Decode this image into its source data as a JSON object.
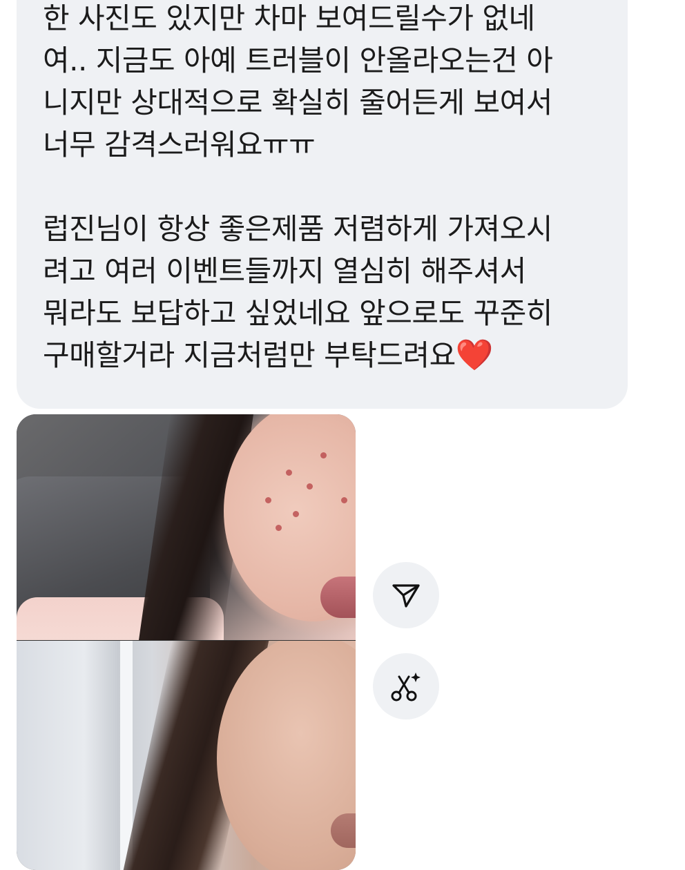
{
  "message": {
    "lines": [
      "한 사진도 있지만 차마 보여드릴수가 없네",
      "여.. 지금도 아예 트러블이 안올라오는건 아",
      "니지만 상대적으로 확실히 줄어든게 보여서",
      "너무 감격스러워요ㅠㅠ",
      "",
      "럽진님이 항상 좋은제품 저렴하게 가져오시",
      "려고 여러 이벤트들까지 열심히 해주셔서",
      "뭐라도 보답하고 싶었네요 앞으로도 꾸준히",
      "구매할거라 지금처럼만 부탁드려요"
    ],
    "emoji": "❤️"
  },
  "actions": {
    "share_icon": "send-icon",
    "remix_icon": "scissors-sparkle-icon"
  },
  "colors": {
    "bubble": "#eff1f4",
    "text": "#1b1b1b",
    "heart": "#e0242f"
  }
}
